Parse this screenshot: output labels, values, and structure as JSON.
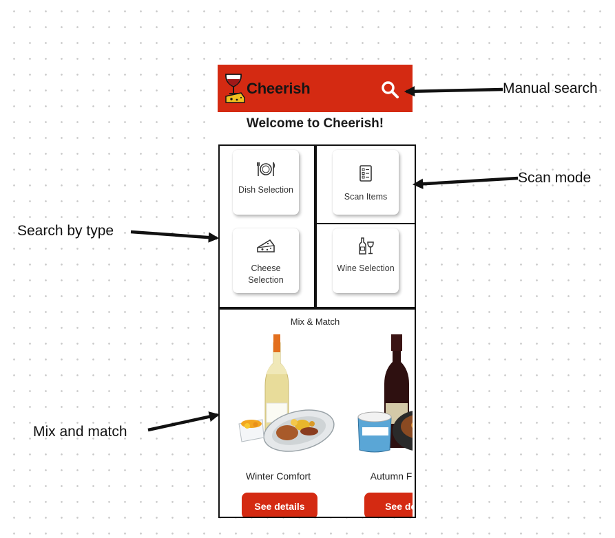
{
  "app": {
    "title": "Cheerish",
    "welcome": "Welcome to Cheerish!"
  },
  "tiles": [
    {
      "label": "Dish Selection",
      "icon": "dish-icon"
    },
    {
      "label": "Scan Items",
      "icon": "scan-list-icon"
    },
    {
      "label": "Cheese Selection",
      "icon": "cheese-icon"
    },
    {
      "label": "Wine Selection",
      "icon": "wine-bottle-glass-icon"
    }
  ],
  "mix": {
    "title": "Mix & Match",
    "cards": [
      {
        "name": "Winter Comfort",
        "button": "See details"
      },
      {
        "name": "Autumn F",
        "button": "See det"
      }
    ]
  },
  "annotations": {
    "manual_search": "Manual search",
    "scan_mode": "Scan mode",
    "search_by_type": "Search by type",
    "mix_and_match": "Mix and match"
  },
  "colors": {
    "brand_red": "#d42a12",
    "background": "#ffffff",
    "dot_grid": "#c9c9c9"
  }
}
